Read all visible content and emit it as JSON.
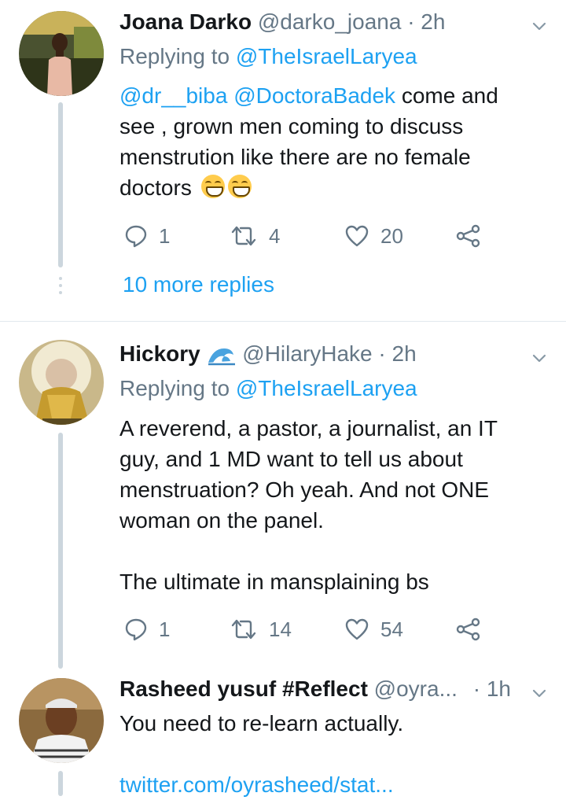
{
  "tweets": [
    {
      "name": "Joana Darko",
      "handle": "@darko_joana",
      "dot": "·",
      "time": "2h",
      "replying_prefix": "Replying to",
      "replying_to": "@TheIsraelLaryea",
      "mention1": "@dr__biba",
      "mention2": "@DoctoraBadek",
      "text": " come and see , grown men coming to discuss menstrution like there are no female doctors",
      "emojis": [
        "grinning-squinting-face",
        "grinning-squinting-face"
      ],
      "replies": "1",
      "retweets": "4",
      "likes": "20",
      "more_replies": "10 more replies"
    },
    {
      "name": "Hickory",
      "badge_icon": "wave-icon",
      "handle": "@HilaryHake",
      "dot": "·",
      "time": "2h",
      "replying_prefix": "Replying to",
      "replying_to": "@TheIsraelLaryea",
      "text_p1": "A reverend, a pastor, a journalist, an IT guy, and 1 MD want to tell us about menstruation? Oh yeah. And not ONE woman on the panel.",
      "text_p2": "The ultimate in mansplaining bs",
      "replies": "1",
      "retweets": "14",
      "likes": "54"
    },
    {
      "name": "Rasheed yusuf #Reflect",
      "handle": "@oyra...",
      "dot": "·",
      "time": "1h",
      "text": "You need to re-learn actually.",
      "link": "twitter.com/oyrasheed/stat..."
    }
  ],
  "colors": {
    "accent": "#1da1f2",
    "secondary_text": "#657786",
    "primary_text": "#14171a",
    "thread_line": "#ccd6dd"
  }
}
